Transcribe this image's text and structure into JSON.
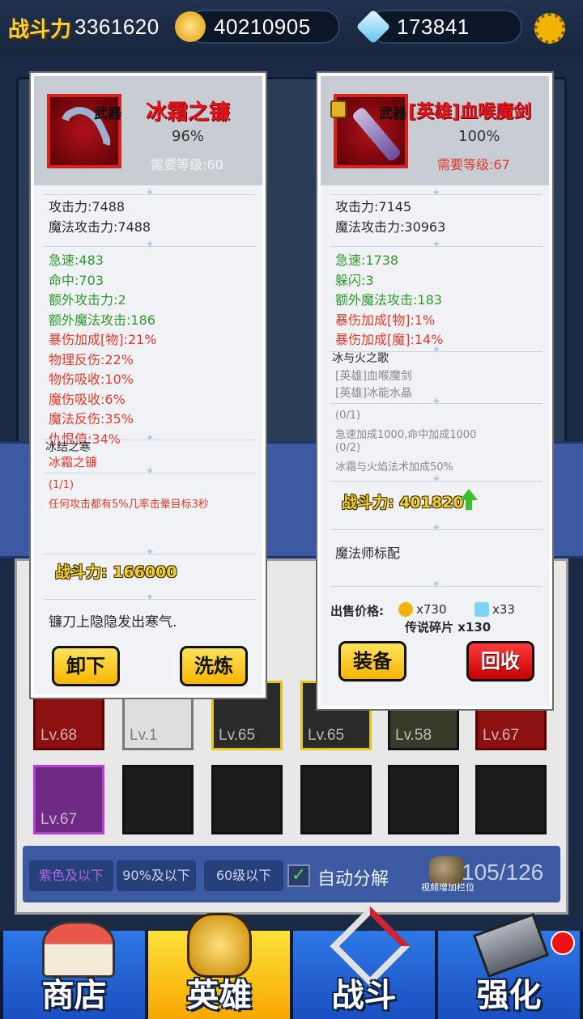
{
  "topbar": {
    "power_label": "战斗力",
    "power_value": "3361620",
    "gold": "40210905",
    "diamond": "173841"
  },
  "left_panel": {
    "category": "武器",
    "name": "冰霜之镰",
    "percent": "96%",
    "required_level": "需要等级:60",
    "base_stats": [
      "攻击力:7488",
      "魔法攻击力:7488"
    ],
    "green_stats": [
      "急速:483",
      "命中:703",
      "额外攻击力:2",
      "额外魔法攻击:186"
    ],
    "red_stats": [
      "暴伤加成[物]:21%",
      "物理反伤:22%",
      "物伤吸收:10%",
      "魔伤吸收:6%",
      "魔法反伤:35%",
      "仇恨值:34%"
    ],
    "set_name": "冰结之寒",
    "set_item": "冰霜之镰",
    "set_progress": "(1/1)",
    "set_bonus": "任何攻击都有5%几率击晕目标3秒",
    "combat_power": "战斗力: 166000",
    "description": "镰刀上隐隐发出寒气.",
    "btn_unequip": "卸下",
    "btn_refine": "洗炼"
  },
  "right_panel": {
    "category": "武器",
    "name": "[英雄]血喉魔剑",
    "percent": "100%",
    "required_level": "需要等级:67",
    "base_stats": [
      "攻击力:7145",
      "魔法攻击力:30963"
    ],
    "green_stats": [
      "急速:1738",
      "躲闪:3",
      "额外魔法攻击:183"
    ],
    "red_stats": [
      "暴伤加成[物]:1%",
      "暴伤加成[魔]:14%"
    ],
    "set_name": "冰与火之歌",
    "set_items": [
      "[英雄]血喉魔剑",
      "[英雄]冰能水晶"
    ],
    "set_progress_1": "(0/1)",
    "set_bonus_1": "急速加成1000,命中加成1000",
    "set_progress_2": "(0/2)",
    "set_bonus_2": "冰霜与火焰法术加成50%",
    "combat_power": "战斗力: 401820",
    "description": "魔法师标配",
    "sell_label": "出售价格:",
    "sell_gold": "x730",
    "sell_gem": "x33",
    "sell_shards": "传说碎片 x130",
    "btn_equip": "装备",
    "btn_recycle": "回收"
  },
  "inventory": {
    "levels": [
      "Lv.68",
      "Lv.1",
      "Lv.65",
      "Lv.65",
      "Lv.58",
      "Lv.67",
      "Lv.67"
    ],
    "filters": [
      "紫色及以下",
      "90%及以下",
      "60级以下"
    ],
    "auto_decompose": "自动分解",
    "count": "105/126",
    "expand_hint": "视频增加栏位"
  },
  "nav": {
    "shop": "商店",
    "hero": "英雄",
    "battle": "战斗",
    "enhance": "强化"
  },
  "colors": {
    "accent_yellow": "#f7d23a",
    "item_red": "#e2141c",
    "stat_green": "#2f9a2f",
    "stat_red": "#e23a2a",
    "nav_blue": "#2e78e5"
  }
}
